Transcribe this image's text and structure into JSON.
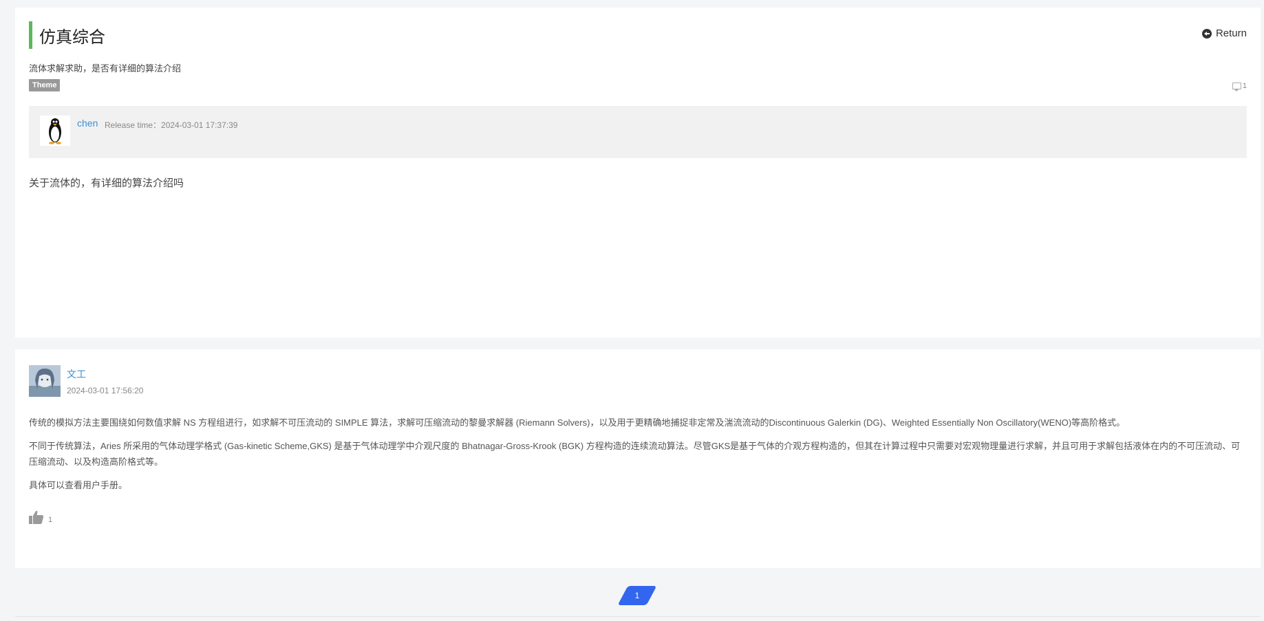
{
  "header": {
    "title": "仿真综合",
    "return_label": "Return"
  },
  "post": {
    "subtitle": "流体求解求助，是否有详细的算法介绍",
    "tag": "Theme",
    "comment_count": "1",
    "author": "chen",
    "release_time": "Release time：2024-03-01 17:37:39",
    "body": "关于流体的，有详细的算法介绍吗"
  },
  "reply": {
    "author": "文工",
    "time": "2024-03-01 17:56:20",
    "paragraphs": [
      "传统的模拟方法主要围绕如何数值求解 NS 方程组进行，如求解不可压流动的 SIMPLE 算法，求解可压缩流动的黎曼求解器 (Riemann Solvers)，以及用于更精确地捕捉非定常及湍流流动的Discontinuous Galerkin (DG)、Weighted Essentially Non Oscillatory(WENO)等高阶格式。",
      "不同于传统算法，Aries 所采用的气体动理学格式 (Gas-kinetic Scheme,GKS) 是基于气体动理学中介观尺度的 Bhatnagar-Gross-Krook (BGK) 方程构造的连续流动算法。尽管GKS是基于气体的介观方程构造的，但其在计算过程中只需要对宏观物理量进行求解，并且可用于求解包括液体在内的不可压流动、可压缩流动、以及构造高阶格式等。",
      "具体可以查看用户手册。"
    ],
    "likes": "1"
  },
  "pagination": {
    "current": "1"
  },
  "colors": {
    "accent_bar": "#5cb85c",
    "link": "#3d8fd1",
    "pager": "#3366ee",
    "tag_bg": "#999999"
  },
  "icons": {
    "return": "return-icon",
    "comment": "comment-icon",
    "like": "thumbs-up-icon"
  }
}
